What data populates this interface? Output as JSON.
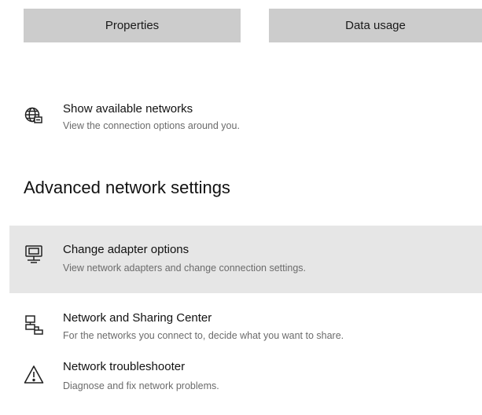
{
  "top_buttons": {
    "properties_label": "Properties",
    "data_usage_label": "Data usage"
  },
  "show_networks": {
    "icon": "globe-network-icon",
    "title": "Show available networks",
    "description": "View the connection options around you."
  },
  "advanced": {
    "heading": "Advanced network settings",
    "items": [
      {
        "icon": "adapter-monitor-icon",
        "title": "Change adapter options",
        "description": "View network adapters and change connection settings."
      },
      {
        "icon": "sharing-center-icon",
        "title": "Network and Sharing Center",
        "description": "For the networks you connect to, decide what you want to share."
      },
      {
        "icon": "warning-triangle-icon",
        "title": "Network troubleshooter",
        "description": "Diagnose and fix network problems."
      }
    ]
  },
  "colors": {
    "button_bg": "#cccccc",
    "hover_bg": "#e6e6e6",
    "description_text": "#6b6b6b"
  }
}
